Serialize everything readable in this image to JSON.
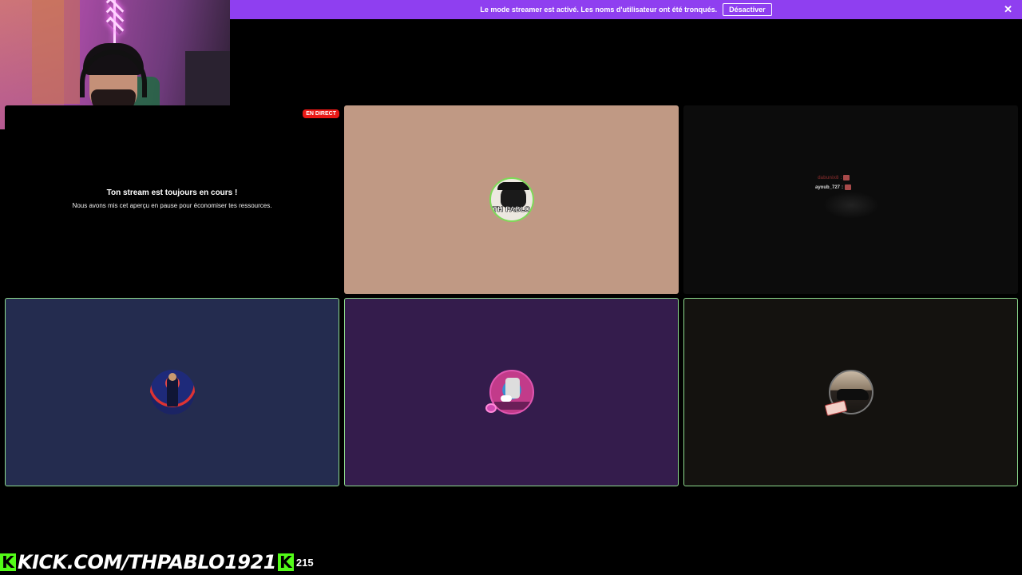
{
  "banner": {
    "message": "Le mode streamer est activé. Les noms d'utilisateur ont été tronqués.",
    "button_label": "Désactiver",
    "close_icon": "close-icon",
    "color": "#8f3ff0"
  },
  "main_tile": {
    "live_badge": "EN DIRECT",
    "title": "Ton stream est toujours en cours !",
    "subtitle": "Nous avons mis cet aperçu en pause pour économiser tes ressources."
  },
  "tile_2": {
    "avatar_label": "TH PABLO"
  },
  "tile_3": {
    "chat": [
      {
        "user": "dabunix8",
        "sep": ":"
      },
      {
        "user": "ayoub_727",
        "sep": ":"
      }
    ]
  },
  "overlay": {
    "kick_letter": "K",
    "url": "KICK.COM/THPABLO1921",
    "viewer_count": "215",
    "accent": "#53fc18"
  },
  "colors": {
    "live_red": "#e91916",
    "tile_border": "#8fdc8f"
  }
}
